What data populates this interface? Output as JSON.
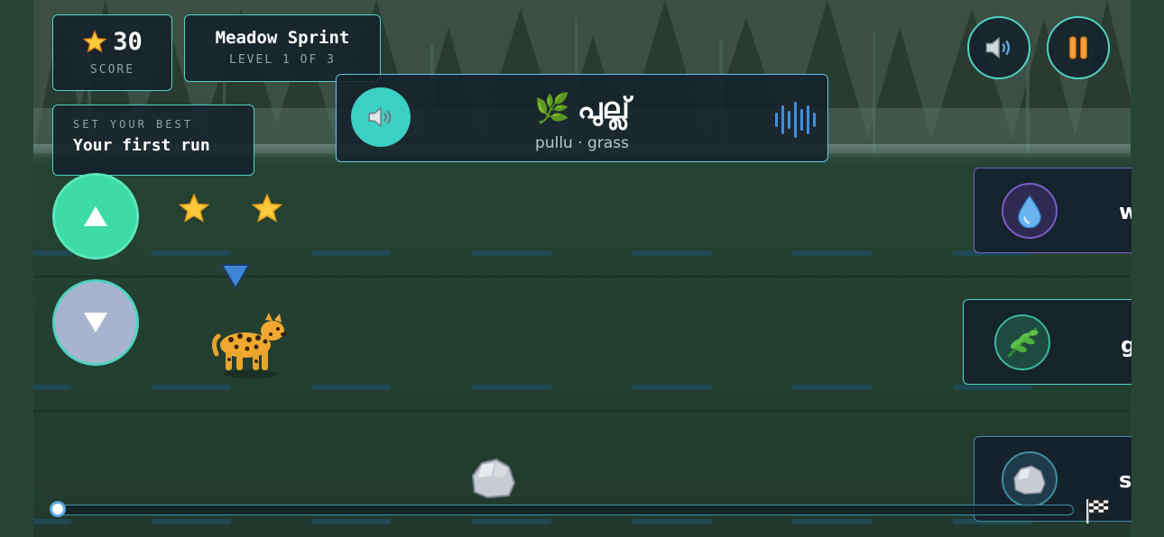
{
  "hud": {
    "score_value": "30",
    "score_label": "SCORE",
    "level_title": "Meadow Sprint",
    "level_subtitle": "LEVEL 1 OF 3",
    "best_label": "SET YOUR BEST",
    "best_value": "Your first run"
  },
  "word_prompt": {
    "emoji": "🌿",
    "native": "പുല്ല്",
    "transliteration": "pullu · grass"
  },
  "answer_cards": [
    {
      "icon": "water-drop-icon",
      "label": "w",
      "accent": "#7b5cc9"
    },
    {
      "icon": "herb-leaf-icon",
      "label": "g",
      "accent": "#3ab89a"
    },
    {
      "icon": "rock-icon",
      "label": "s",
      "accent": "#3f8ea0"
    }
  ],
  "progress": {
    "fraction": 0.0
  },
  "colors": {
    "accent": "#4fd2c0",
    "up_button": "#3edba6",
    "down_button": "#a8b4cf",
    "speaker": "#3ad0c3"
  },
  "icons": [
    "star-icon",
    "speaker-icon",
    "sound-wave-icon",
    "pause-icon",
    "up-arrow-icon",
    "down-arrow-icon",
    "leopard-icon",
    "rock-icon",
    "checkered-flag-icon"
  ]
}
